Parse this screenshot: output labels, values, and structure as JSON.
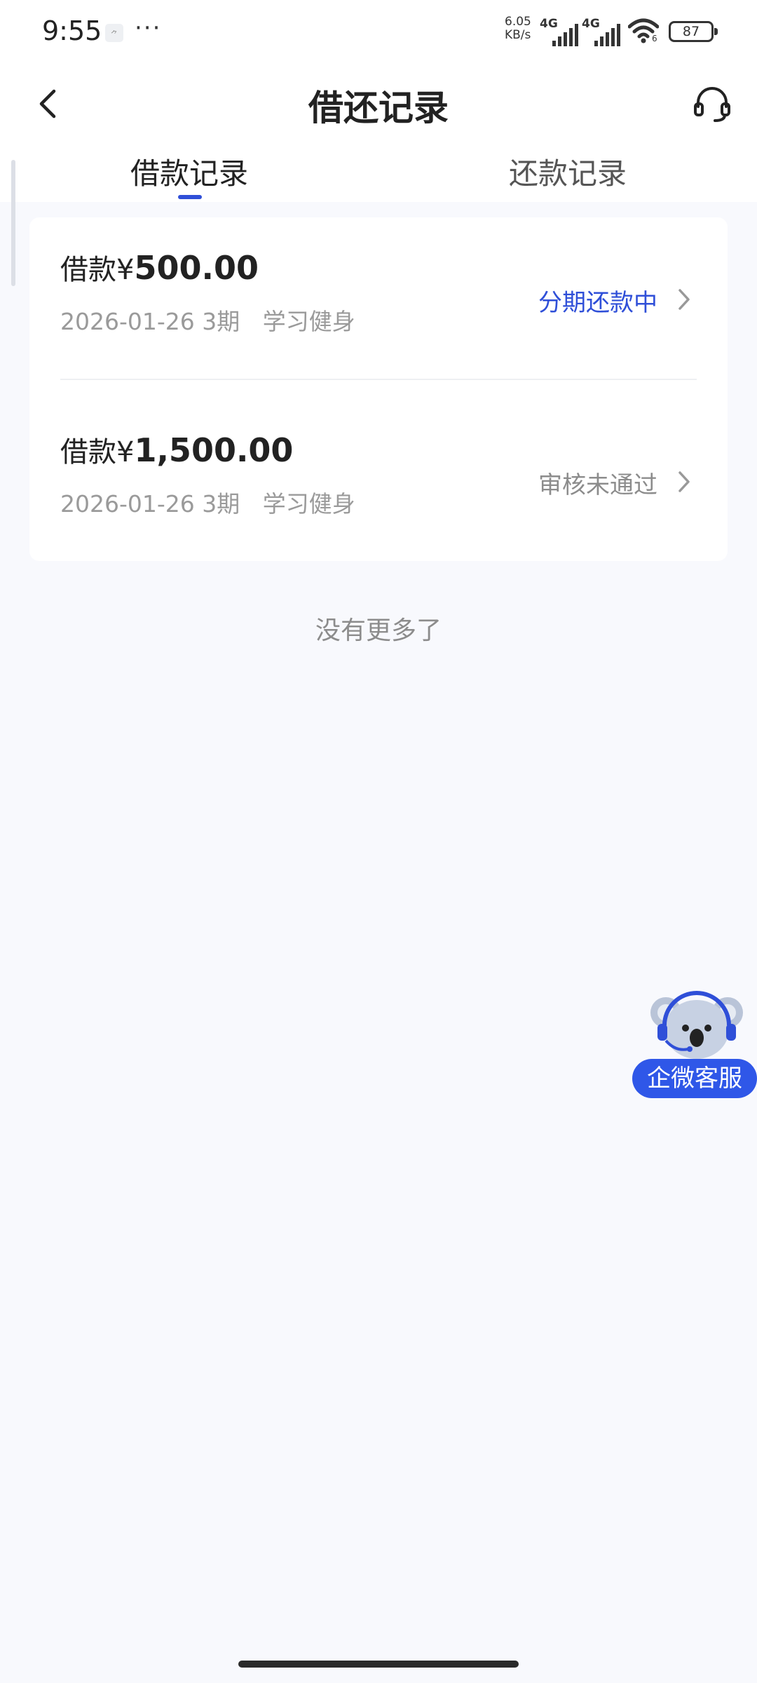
{
  "status_bar": {
    "time": "9:55",
    "app_icon_text": "⺈",
    "more": "···",
    "net_speed": "6.05",
    "net_unit": "KB/s",
    "sim1": "4G",
    "sim2": "4G",
    "wifi_sub": "6",
    "battery": "87"
  },
  "header": {
    "title": "借还记录",
    "back_icon": "chevron-left-icon",
    "cs_icon": "headset-icon"
  },
  "tabs": [
    {
      "label": "借款记录",
      "active": true
    },
    {
      "label": "还款记录",
      "active": false
    }
  ],
  "records": [
    {
      "prefix": "借款¥",
      "amount": "500.00",
      "date": "2026-01-26",
      "terms": "3期",
      "purpose": "学习健身",
      "status": "分期还款中",
      "status_color": "#2f4fd8"
    },
    {
      "prefix": "借款¥",
      "amount": "1,500.00",
      "date": "2026-01-26",
      "terms": "3期",
      "purpose": "学习健身",
      "status": "审核未通过",
      "status_color": "#8c8c8c"
    }
  ],
  "footer_text": "没有更多了",
  "float_cs": {
    "label": "企微客服",
    "color": "#2f57e8"
  }
}
